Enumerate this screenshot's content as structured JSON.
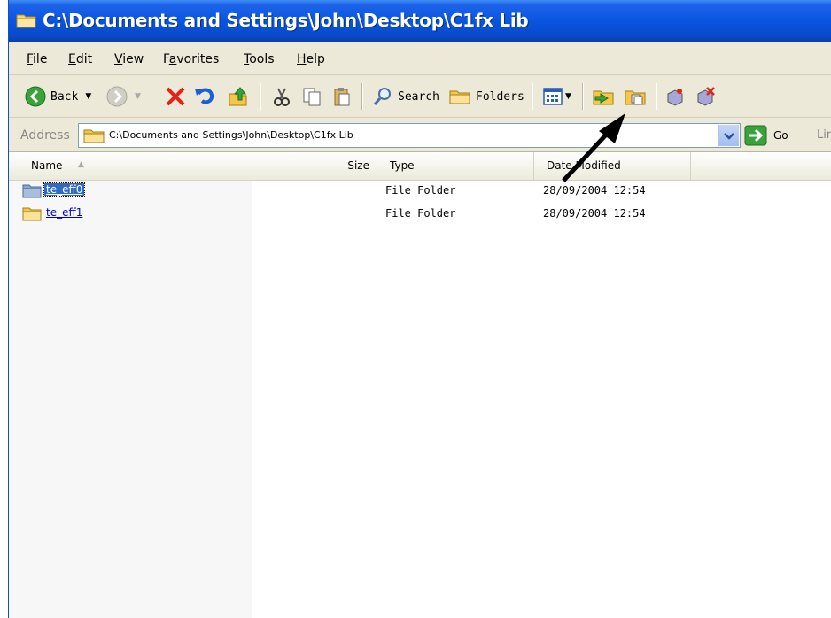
{
  "window": {
    "title": "C:\\Documents and Settings\\John\\Desktop\\C1fx Lib"
  },
  "menu": {
    "items": [
      {
        "label": "File",
        "accel": "F",
        "rest": "ile"
      },
      {
        "label": "Edit",
        "accel": "E",
        "rest": "dit"
      },
      {
        "label": "View",
        "accel": "V",
        "rest": "iew"
      },
      {
        "label": "Favorites",
        "accel": "a",
        "pre": "F",
        "rest": "vorites"
      },
      {
        "label": "Tools",
        "accel": "T",
        "rest": "ools"
      },
      {
        "label": "Help",
        "accel": "H",
        "rest": "elp"
      }
    ]
  },
  "toolbar": {
    "back_label": "Back",
    "search_label": "Search",
    "folders_label": "Folders",
    "icons": [
      "back-icon",
      "forward-icon",
      "delete-icon",
      "undo-icon",
      "up-folder-icon",
      "cut-icon",
      "copy-icon",
      "paste-icon",
      "search-icon",
      "folders-icon",
      "views-icon",
      "move-to-icon",
      "copy-to-icon",
      "properties-icon",
      "close-icon"
    ]
  },
  "address": {
    "label": "Address",
    "value": "C:\\Documents and Settings\\John\\Desktop\\C1fx Lib",
    "go_label": "Go",
    "links_label": "Lin"
  },
  "columns": {
    "name": "Name",
    "size": "Size",
    "type": "Type",
    "date": "Date Modified"
  },
  "files": [
    {
      "name": "te_eff0",
      "size": "",
      "type": "File Folder",
      "date": "28/09/2004 12:54",
      "selected": true
    },
    {
      "name": "te_eff1",
      "size": "",
      "type": "File Folder",
      "date": "28/09/2004 12:54",
      "selected": false
    }
  ],
  "colors": {
    "title_bar": "#0a55e0",
    "chrome": "#ece9d8",
    "selection": "#316ac5",
    "go_green": "#3aa23a"
  }
}
